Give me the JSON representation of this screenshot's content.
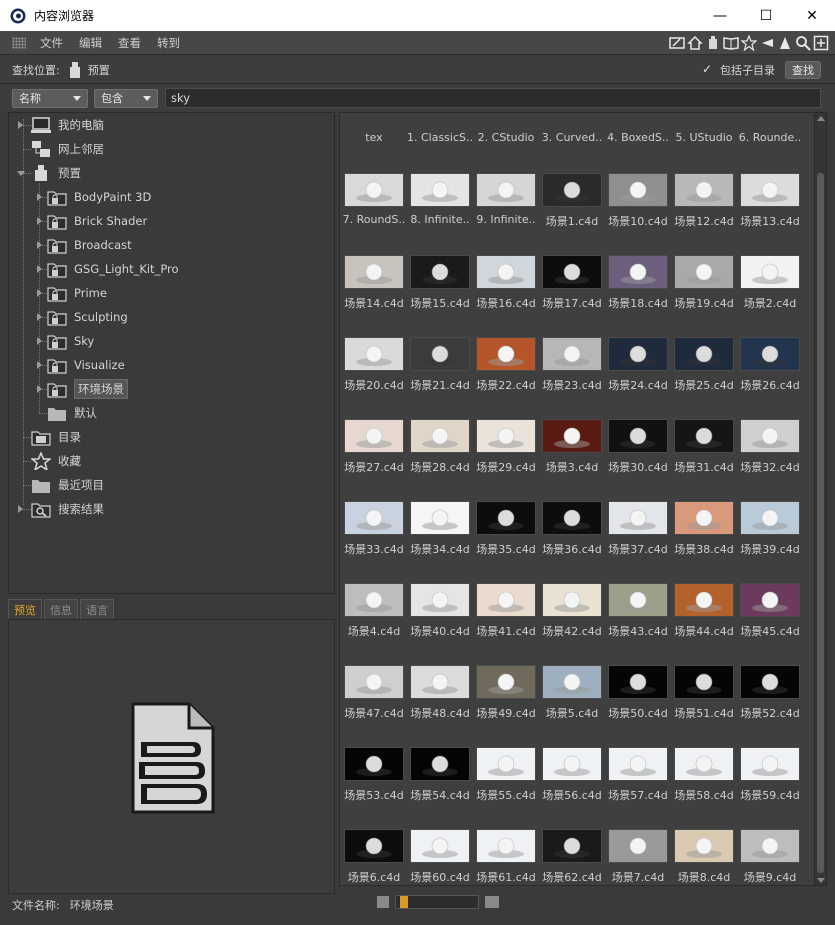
{
  "window": {
    "title": "内容浏览器",
    "controls": [
      "—",
      "☐",
      "✕"
    ]
  },
  "menu": {
    "items": [
      "文件",
      "编辑",
      "查看",
      "转到"
    ]
  },
  "toolbar_icons": [
    "edit-icon",
    "home-icon",
    "preset-icon",
    "book-icon",
    "star-icon",
    "back-icon",
    "up-icon",
    "search-icon",
    "new-icon"
  ],
  "location": {
    "label": "查找位置:",
    "value": "预置",
    "include_sub_label": "包括子目录",
    "include_sub_checked": true,
    "find_button": "查找"
  },
  "filter": {
    "field_option": "名称",
    "op_option": "包含",
    "search_value": "sky"
  },
  "tree": [
    {
      "label": "我的电脑",
      "icon": "computer-icon",
      "level": 0
    },
    {
      "label": "网上邻居",
      "icon": "network-icon",
      "level": 0
    },
    {
      "label": "预置",
      "icon": "preset-icon",
      "level": 0
    },
    {
      "label": "BodyPaint 3D",
      "icon": "folder-lock-icon",
      "level": 1
    },
    {
      "label": "Brick Shader",
      "icon": "folder-lock-icon",
      "level": 1
    },
    {
      "label": "Broadcast",
      "icon": "folder-lock-icon",
      "level": 1
    },
    {
      "label": "GSG_Light_Kit_Pro",
      "icon": "folder-lock-icon",
      "level": 1
    },
    {
      "label": "Prime",
      "icon": "folder-lock-icon",
      "level": 1
    },
    {
      "label": "Sculpting",
      "icon": "folder-lock-icon",
      "level": 1
    },
    {
      "label": "Sky",
      "icon": "folder-lock-icon",
      "level": 1
    },
    {
      "label": "Visualize",
      "icon": "folder-lock-icon",
      "level": 1
    },
    {
      "label": "环境场景",
      "icon": "folder-lock-icon",
      "level": 1,
      "selected": true
    },
    {
      "label": "默认",
      "icon": "folder-icon",
      "level": 1
    },
    {
      "label": "目录",
      "icon": "catalog-icon",
      "level": 0
    },
    {
      "label": "收藏",
      "icon": "star-icon",
      "level": 0
    },
    {
      "label": "最近项目",
      "icon": "folder-icon",
      "level": 0
    },
    {
      "label": "搜索结果",
      "icon": "search-results-icon",
      "level": 0
    }
  ],
  "preview_tabs": [
    "预览",
    "信息",
    "语言"
  ],
  "file_name": {
    "label": "文件名称:",
    "value": "环境场景"
  },
  "grid_items": [
    {
      "name": "tex",
      "bg": "#3f3f3f"
    },
    {
      "name": "1. ClassicS..",
      "bg": "#3f3f3f"
    },
    {
      "name": "2. CStudio",
      "bg": "#3f3f3f"
    },
    {
      "name": "3. Curved..",
      "bg": "#3f3f3f"
    },
    {
      "name": "4. BoxedS..",
      "bg": "#3f3f3f"
    },
    {
      "name": "5. UStudio",
      "bg": "#3f3f3f"
    },
    {
      "name": "6. Rounde..",
      "bg": "#3f3f3f"
    },
    {
      "name": "7. RoundS..",
      "bg": "#d9d9d9"
    },
    {
      "name": "8. Infinite..",
      "bg": "#e4e4e4"
    },
    {
      "name": "9. Infinite..",
      "bg": "#d6d6d6"
    },
    {
      "name": "场景1.c4d",
      "bg": "#2a2a2a"
    },
    {
      "name": "场景10.c4d",
      "bg": "#8f8f8f"
    },
    {
      "name": "场景12.c4d",
      "bg": "#b8b8b8"
    },
    {
      "name": "场景13.c4d",
      "bg": "#dcdcdc"
    },
    {
      "name": "场景14.c4d",
      "bg": "#c9c3bd"
    },
    {
      "name": "场景15.c4d",
      "bg": "#1a1a1a"
    },
    {
      "name": "场景16.c4d",
      "bg": "#cfd6dc"
    },
    {
      "name": "场景17.c4d",
      "bg": "#0c0c0c"
    },
    {
      "name": "场景18.c4d",
      "bg": "#6b5f7d"
    },
    {
      "name": "场景19.c4d",
      "bg": "#a9a9a9"
    },
    {
      "name": "场景2.c4d",
      "bg": "#f2f2f2"
    },
    {
      "name": "场景20.c4d",
      "bg": "#dadada"
    },
    {
      "name": "场景21.c4d",
      "bg": "#3c3c3c"
    },
    {
      "name": "场景22.c4d",
      "bg": "#b4562a"
    },
    {
      "name": "场景23.c4d",
      "bg": "#b7b7b7"
    },
    {
      "name": "场景24.c4d",
      "bg": "#1f2a3c"
    },
    {
      "name": "场景25.c4d",
      "bg": "#1f2a3c"
    },
    {
      "name": "场景26.c4d",
      "bg": "#23344e"
    },
    {
      "name": "场景27.c4d",
      "bg": "#e6d8d0"
    },
    {
      "name": "场景28.c4d",
      "bg": "#e0d6c8"
    },
    {
      "name": "场景29.c4d",
      "bg": "#e9e3da"
    },
    {
      "name": "场景3.c4d",
      "bg": "#5a1c12"
    },
    {
      "name": "场景30.c4d",
      "bg": "#111111"
    },
    {
      "name": "场景31.c4d",
      "bg": "#151515"
    },
    {
      "name": "场景32.c4d",
      "bg": "#d0d0d0"
    },
    {
      "name": "场景33.c4d",
      "bg": "#c9d3df"
    },
    {
      "name": "场景34.c4d",
      "bg": "#f5f5f5"
    },
    {
      "name": "场景35.c4d",
      "bg": "#0d0d0d"
    },
    {
      "name": "场景36.c4d",
      "bg": "#0d0d0d"
    },
    {
      "name": "场景37.c4d",
      "bg": "#e3e6ea"
    },
    {
      "name": "场景38.c4d",
      "bg": "#d99a7c"
    },
    {
      "name": "场景39.c4d",
      "bg": "#b9cad9"
    },
    {
      "name": "场景4.c4d",
      "bg": "#bdbdbd"
    },
    {
      "name": "场景40.c4d",
      "bg": "#e5e5e5"
    },
    {
      "name": "场景41.c4d",
      "bg": "#eadbcf"
    },
    {
      "name": "场景42.c4d",
      "bg": "#e9e2d3"
    },
    {
      "name": "场景43.c4d",
      "bg": "#9aa08a"
    },
    {
      "name": "场景44.c4d",
      "bg": "#b4622c"
    },
    {
      "name": "场景45.c4d",
      "bg": "#6b3a5c"
    },
    {
      "name": "场景47.c4d",
      "bg": "#cfcfcf"
    },
    {
      "name": "场景48.c4d",
      "bg": "#dcdcdc"
    },
    {
      "name": "场景49.c4d",
      "bg": "#6f6a5c"
    },
    {
      "name": "场景5.c4d",
      "bg": "#9eb0bf"
    },
    {
      "name": "场景50.c4d",
      "bg": "#050505"
    },
    {
      "name": "场景51.c4d",
      "bg": "#050505"
    },
    {
      "name": "场景52.c4d",
      "bg": "#050505"
    },
    {
      "name": "场景53.c4d",
      "bg": "#050505"
    },
    {
      "name": "场景54.c4d",
      "bg": "#050505"
    },
    {
      "name": "场景55.c4d",
      "bg": "#eef2f4"
    },
    {
      "name": "场景56.c4d",
      "bg": "#eef2f4"
    },
    {
      "name": "场景57.c4d",
      "bg": "#eef2f4"
    },
    {
      "name": "场景58.c4d",
      "bg": "#eef2f4"
    },
    {
      "name": "场景59.c4d",
      "bg": "#eef2f4"
    },
    {
      "name": "场景6.c4d",
      "bg": "#0d0d0d"
    },
    {
      "name": "场景60.c4d",
      "bg": "#eef2f4"
    },
    {
      "name": "场景61.c4d",
      "bg": "#eef2f4"
    },
    {
      "name": "场景62.c4d",
      "bg": "#1a1a1a"
    },
    {
      "name": "场景7.c4d",
      "bg": "#9a9a9a"
    },
    {
      "name": "场景8.c4d",
      "bg": "#d8c9b0"
    },
    {
      "name": "场景9.c4d",
      "bg": "#bdbdbd"
    }
  ]
}
